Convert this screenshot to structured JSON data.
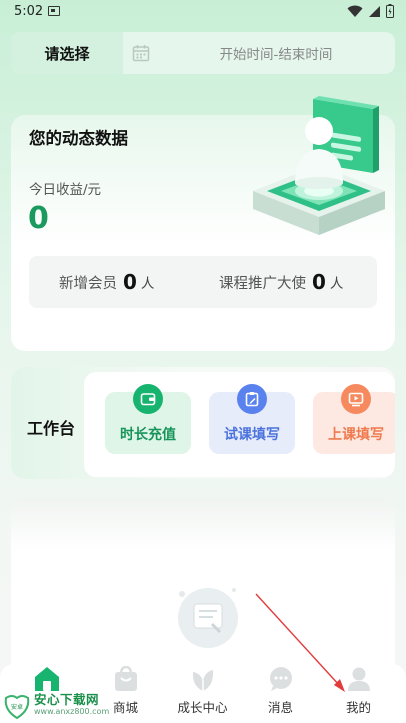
{
  "status_bar": {
    "time": "5:02"
  },
  "date_filter": {
    "select_label": "请选择",
    "range_placeholder": "开始时间-结束时间"
  },
  "dynamic_data": {
    "title": "您的动态数据",
    "earnings_label": "今日收益/元",
    "earnings_value": "0",
    "new_members_label": "新增会员",
    "new_members_value": "0",
    "new_members_unit": "人",
    "ambassador_label": "课程推广大使",
    "ambassador_value": "0",
    "ambassador_unit": "人"
  },
  "workbench": {
    "title": "工作台",
    "tools": [
      {
        "label": "时长充值",
        "icon": "wallet-icon",
        "color": "#17b46f"
      },
      {
        "label": "试课填写",
        "icon": "clipboard-edit-icon",
        "color": "#5a82ee"
      },
      {
        "label": "上课填写",
        "icon": "video-play-icon",
        "color": "#f7895f"
      }
    ]
  },
  "tabbar": {
    "items": [
      {
        "label": "",
        "icon": "home-icon",
        "active": true
      },
      {
        "label": "商城",
        "icon": "shopping-bag-icon"
      },
      {
        "label": "成长中心",
        "icon": "leaf-icon"
      },
      {
        "label": "消息",
        "icon": "chat-bubble-icon"
      },
      {
        "label": "我的",
        "icon": "person-icon"
      }
    ]
  },
  "watermark": {
    "brand": "安心下载网",
    "url": "www.anxz800.com",
    "logo_text": "安卓"
  },
  "colors": {
    "accent_green": "#1b9a5e",
    "tool_blue": "#5a82ee",
    "tool_orange": "#f7895f"
  }
}
